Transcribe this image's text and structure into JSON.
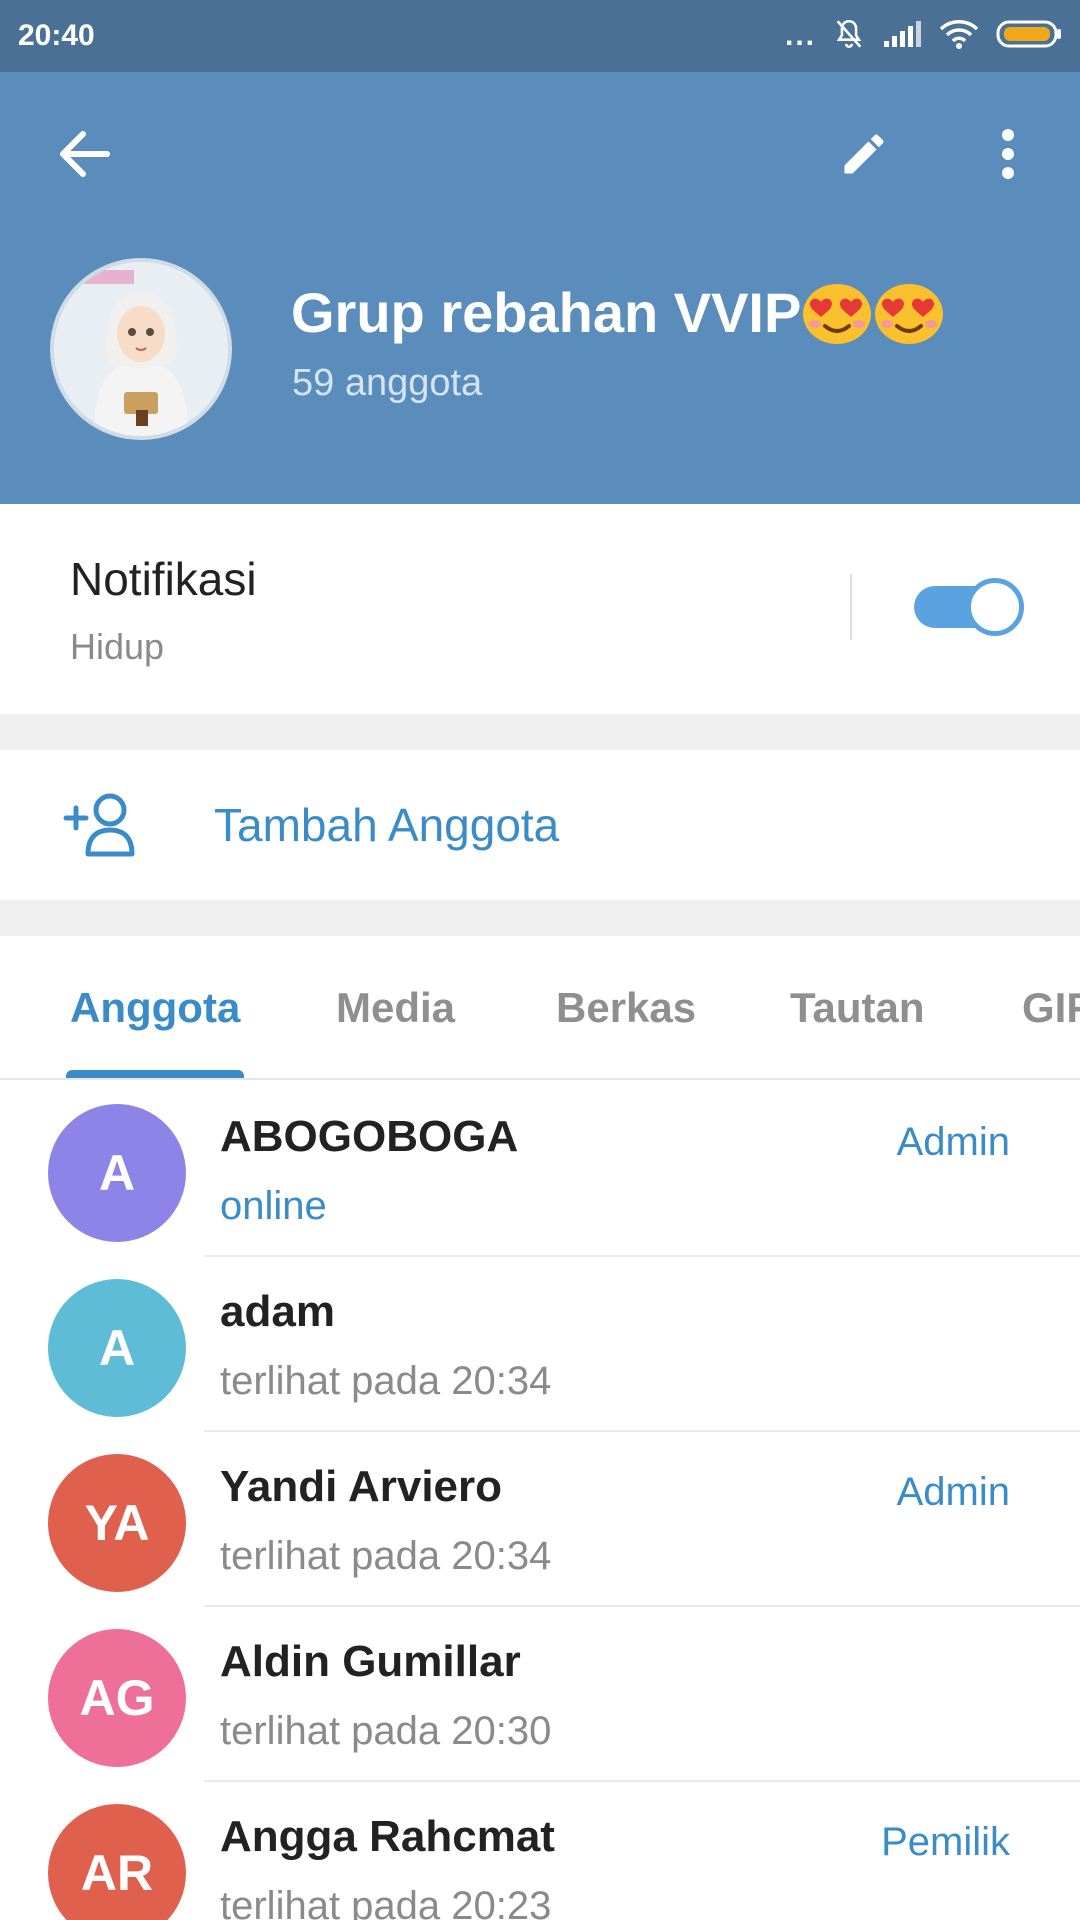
{
  "status_bar": {
    "time": "20:40",
    "dots": "..."
  },
  "header": {
    "title": "Grup rebahan VVIP",
    "subtitle": "59 anggota"
  },
  "notification": {
    "title": "Notifikasi",
    "status": "Hidup",
    "enabled": true
  },
  "add_member": {
    "label": "Tambah Anggota"
  },
  "tabs": [
    "Anggota",
    "Media",
    "Berkas",
    "Tautan",
    "GIF"
  ],
  "members": [
    {
      "initials": "A",
      "name": "ABOGOBOGA",
      "status": "online",
      "role": "Admin",
      "color": "#8e84e8"
    },
    {
      "initials": "A",
      "name": "adam",
      "status": "terlihat pada  20:34",
      "role": "",
      "color": "#5fbcd6"
    },
    {
      "initials": "YA",
      "name": "Yandi Arviero",
      "status": "terlihat pada  20:34",
      "role": "Admin",
      "color": "#e0604e"
    },
    {
      "initials": "AG",
      "name": "Aldin Gumillar",
      "status": "terlihat pada  20:30",
      "role": "",
      "color": "#ee6f97"
    },
    {
      "initials": "AR",
      "name": "Angga Rahcmat",
      "status": "terlihat pada  20:23",
      "role": "Pemilik",
      "color": "#e0604e"
    }
  ],
  "colors": {
    "header": "#5a8dbb",
    "statusbar": "#4a7096",
    "accent": "#3a8cc9"
  },
  "icons": [
    "back-arrow-icon",
    "pencil-icon",
    "more-vertical-icon",
    "muted-bell-icon",
    "signal-icon",
    "wifi-icon",
    "battery-icon",
    "add-person-icon"
  ]
}
